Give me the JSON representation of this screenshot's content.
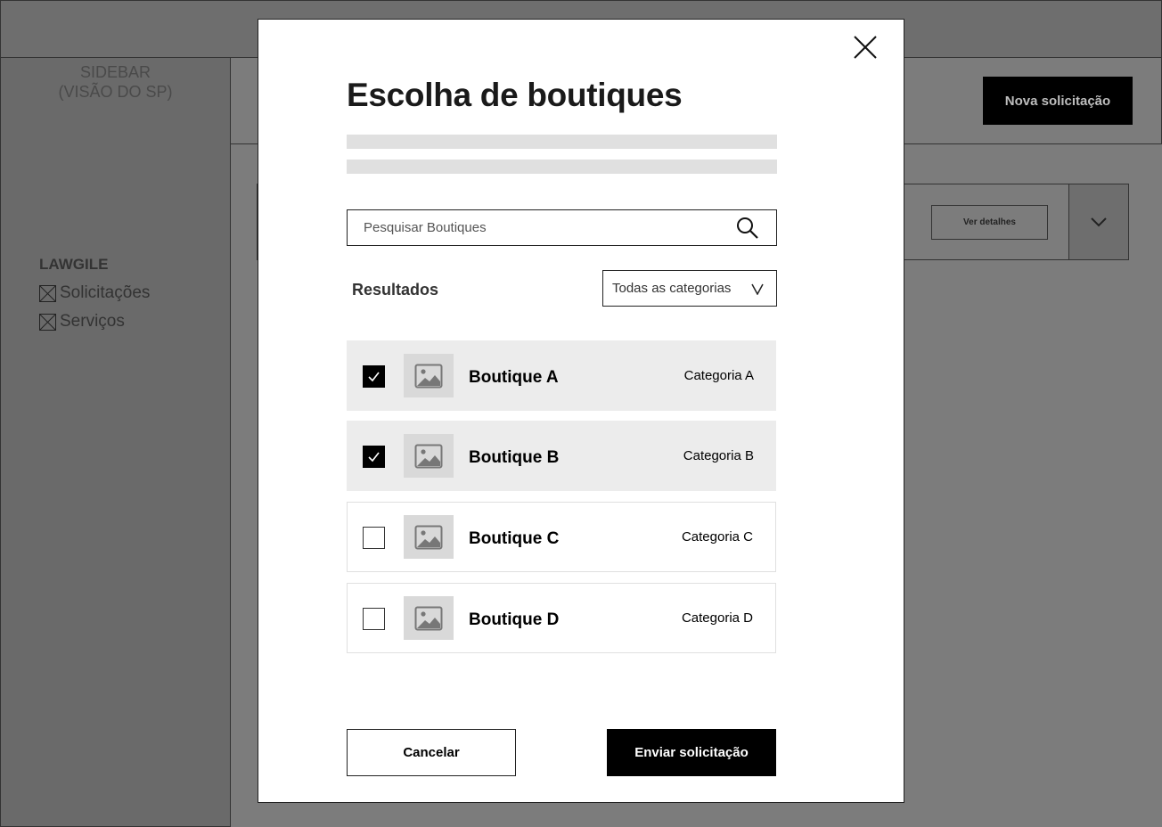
{
  "background": {
    "sidebar_caption": "SIDEBAR\n(VISÃO DO SP)",
    "brand": "LAWGILE",
    "nav_items": [
      {
        "label": "Solicitações",
        "icon": "placeholder-box-icon"
      },
      {
        "label": "Serviços",
        "icon": "placeholder-box-icon"
      }
    ],
    "new_request_label": "Nova solicitação",
    "details_label": "Ver detalhes"
  },
  "modal": {
    "title": "Escolha de boutiques",
    "search_placeholder": "Pesquisar Boutiques",
    "results_label": "Resultados",
    "category_filter": "Todas as categorias",
    "boutiques": [
      {
        "name": "Boutique A",
        "category": "Categoria A",
        "selected": true
      },
      {
        "name": "Boutique B",
        "category": "Categoria B",
        "selected": true
      },
      {
        "name": "Boutique C",
        "category": "Categoria C",
        "selected": false
      },
      {
        "name": "Boutique D",
        "category": "Categoria D",
        "selected": false
      }
    ],
    "cancel_label": "Cancelar",
    "submit_label": "Enviar solicitação"
  },
  "colors": {
    "overlay": "#7c7c7c",
    "primary_button": "#000000",
    "selected_row": "#ececec",
    "placeholder_line": "#e0e0e0"
  }
}
